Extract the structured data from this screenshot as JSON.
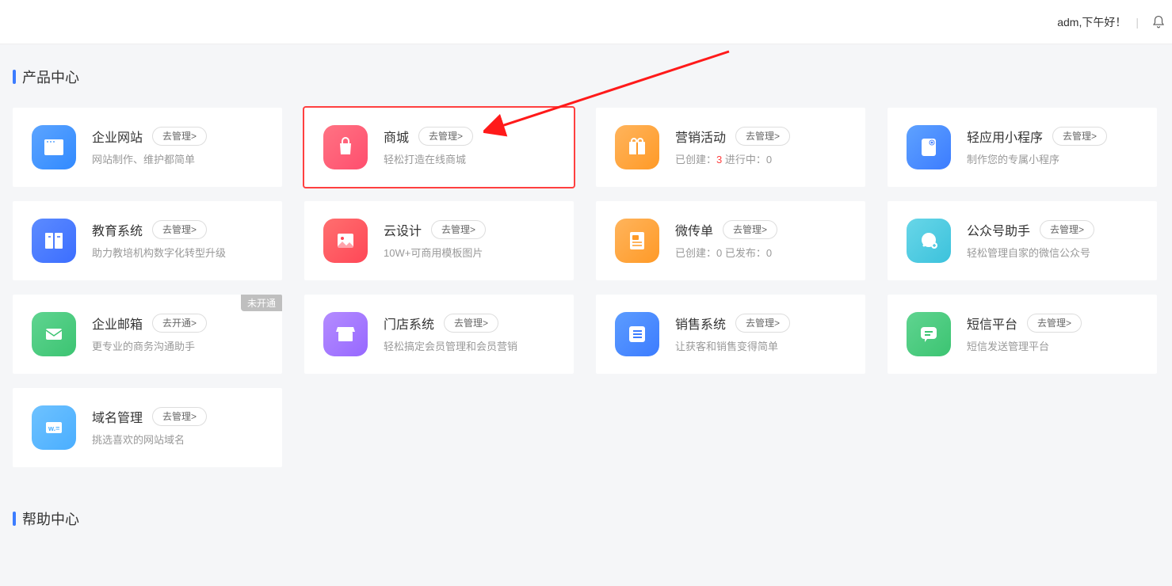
{
  "header": {
    "greeting": "adm,下午好！"
  },
  "sections": {
    "products_title": "产品中心",
    "help_title": "帮助中心"
  },
  "cards": [
    {
      "title": "企业网站",
      "btn": "去管理>",
      "desc": "网站制作、维护都简单",
      "icon": "browser",
      "grad": "g-blue1"
    },
    {
      "title": "商城",
      "btn": "去管理>",
      "desc": "轻松打造在线商城",
      "icon": "bag",
      "grad": "g-pink",
      "highlight": true
    },
    {
      "title": "营销活动",
      "btn": "去管理>",
      "stats": [
        {
          "label": "已创建：",
          "value": "3",
          "cls": "num"
        },
        {
          "label": "  进行中：",
          "value": "0",
          "cls": "num-gray"
        }
      ],
      "icon": "gift",
      "grad": "g-orange"
    },
    {
      "title": "轻应用小程序",
      "btn": "去管理>",
      "desc": "制作您的专属小程序",
      "icon": "mini",
      "grad": "g-blue2"
    },
    {
      "title": "教育系统",
      "btn": "去管理>",
      "desc": "助力教培机构数字化转型升级",
      "icon": "book",
      "grad": "g-deepblue"
    },
    {
      "title": "云设计",
      "btn": "去管理>",
      "desc": "10W+可商用模板图片",
      "icon": "image",
      "grad": "g-red"
    },
    {
      "title": "微传单",
      "btn": "去管理>",
      "stats": [
        {
          "label": "已创建：",
          "value": "0",
          "cls": "num-gray"
        },
        {
          "label": "  已发布：",
          "value": "0",
          "cls": "num-gray"
        }
      ],
      "icon": "flyer",
      "grad": "g-orange"
    },
    {
      "title": "公众号助手",
      "btn": "去管理>",
      "desc": "轻松管理自家的微信公众号",
      "icon": "wechat",
      "grad": "g-teal"
    },
    {
      "title": "企业邮箱",
      "btn": "去开通>",
      "desc": "更专业的商务沟通助手",
      "icon": "mail",
      "grad": "g-green",
      "badge": "未开通"
    },
    {
      "title": "门店系统",
      "btn": "去管理>",
      "desc": "轻松搞定会员管理和会员营销",
      "icon": "store",
      "grad": "g-purple"
    },
    {
      "title": "销售系统",
      "btn": "去管理>",
      "desc": "让获客和销售变得简单",
      "icon": "list",
      "grad": "g-blue3"
    },
    {
      "title": "短信平台",
      "btn": "去管理>",
      "desc": "短信发送管理平台",
      "icon": "chat",
      "grad": "g-green2"
    },
    {
      "title": "域名管理",
      "btn": "去管理>",
      "desc": "挑选喜欢的网站域名",
      "icon": "domain",
      "grad": "g-sky"
    }
  ]
}
